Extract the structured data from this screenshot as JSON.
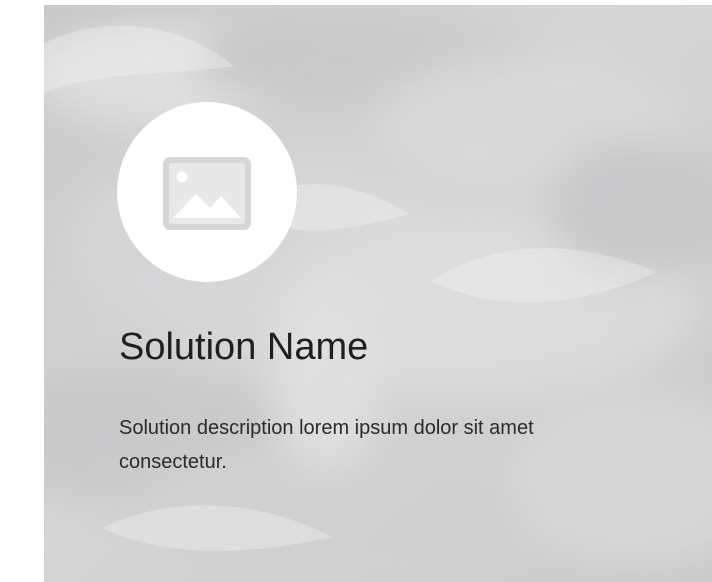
{
  "solution_card": {
    "image_placeholder_icon": "image-placeholder-icon",
    "title": "Solution Name",
    "description": "Solution description lorem ipsum dolor sit amet consectetur."
  }
}
